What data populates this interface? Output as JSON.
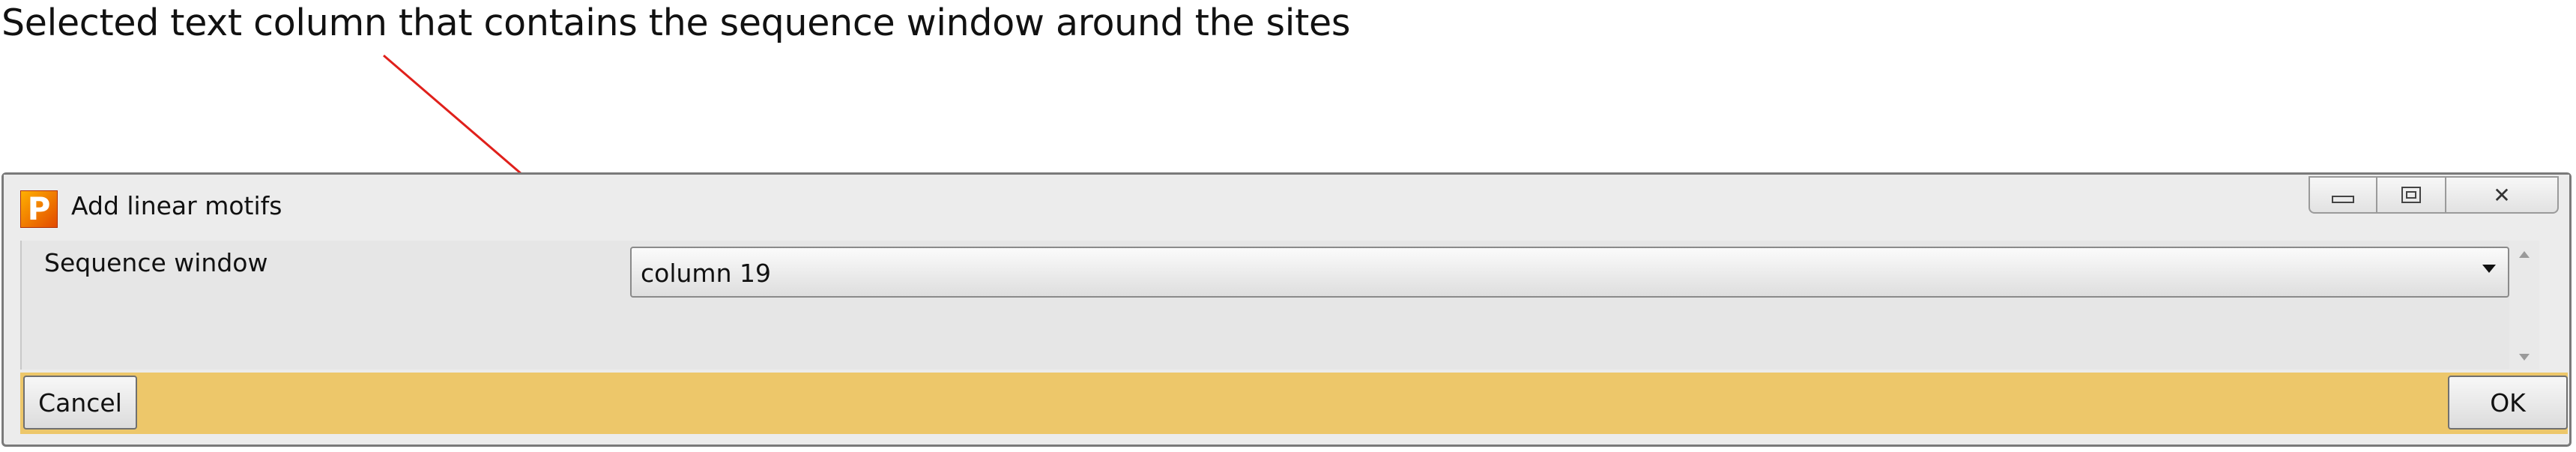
{
  "annotation": {
    "text": "Selected text column that contains the sequence window around the sites",
    "arrow_color": "#e0201b"
  },
  "dialog": {
    "title": "Add linear motifs",
    "app_icon": "P",
    "window_controls": [
      "minimize-icon",
      "maximize-icon",
      "close-icon"
    ],
    "close_glyph": "✕"
  },
  "form": {
    "field_label": "Sequence window",
    "selected_value": "column 19"
  },
  "buttons": {
    "cancel_label": "Cancel",
    "ok_label": "OK"
  },
  "colors": {
    "footer_bg": "#edc76a",
    "dialog_bg": "#ececec"
  }
}
